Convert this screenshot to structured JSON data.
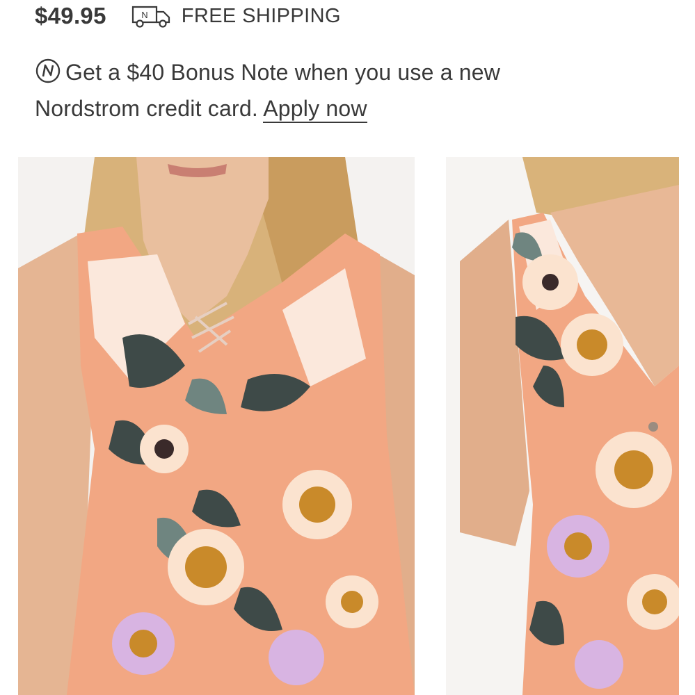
{
  "product": {
    "price": "$49.95",
    "shipping_label": "FREE SHIPPING",
    "shipping_icon": "truck-icon"
  },
  "promo": {
    "icon": "nordstrom-note-icon",
    "text": "Get a $40 Bonus Note when you use a new Nordstrom credit card.",
    "link_label": "Apply now"
  },
  "gallery": {
    "images": [
      {
        "name": "front-view",
        "description_icon": "product-photo"
      },
      {
        "name": "back-view",
        "description_icon": "product-photo"
      }
    ]
  },
  "colors": {
    "text": "#393939",
    "background": "#ffffff",
    "dress_peach": "#f2a783",
    "dress_leaf": "#3e4a48",
    "dress_mustard": "#c98a2a",
    "dress_lilac": "#d8b4e2",
    "skin": "#e8b896",
    "hair": "#d9b37a"
  }
}
